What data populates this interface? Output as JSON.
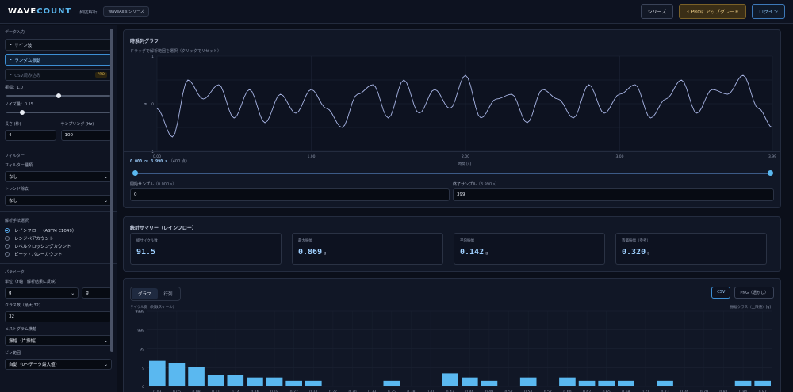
{
  "header": {
    "logo_main": "WAVE",
    "logo_accent": "COUNT",
    "subtitle": "頻度解析",
    "series_pill": "WaveAxis シリーズ",
    "series_button": "シリーズ",
    "pro_button": "PROにアップグレード",
    "login_button": "ログイン"
  },
  "sidebar": {
    "data_input": {
      "heading": "データ入力",
      "options": [
        {
          "label": "サイン波",
          "active": false
        },
        {
          "label": "ランダム振動",
          "active": true
        },
        {
          "label": "CSV読み込み",
          "tag": "PRO",
          "active": false
        }
      ],
      "amplitude_label": "振幅：1.0",
      "amplitude_level": 0.5,
      "noise_label": "ノイズ量：0.15",
      "noise_level": 0.15,
      "length_label": "長さ (秒)",
      "length_value": "4",
      "sampling_label": "サンプリング (Hz)",
      "sampling_value": "100"
    },
    "filter": {
      "heading": "フィルター",
      "type_label": "フィルター種類",
      "type_value": "なし",
      "trend_label": "トレンド除去",
      "trend_value": "なし"
    },
    "method": {
      "heading": "解析手法選択",
      "options": [
        {
          "label": "レインフロー（ASTM E1049）",
          "checked": true
        },
        {
          "label": "レンジペアカウント",
          "checked": false
        },
        {
          "label": "レベルクロッシングカウント",
          "checked": false
        },
        {
          "label": "ピーク・バレーカウント",
          "checked": false
        }
      ]
    },
    "params": {
      "heading": "パラメータ",
      "unit_label": "単位（Y軸・解析結果に反映）",
      "unit_value": "g",
      "unit_custom": "g",
      "class_label": "クラス数（最大 32）",
      "class_value": "32",
      "hist_label": "ヒストグラム横軸",
      "hist_value": "振幅（片振幅）",
      "bin_label": "ビン範囲",
      "bin_value": "自動（0〜データ最大値）"
    },
    "chevron": "˄"
  },
  "timeseries": {
    "title": "時系列グラフ",
    "hint": "ドラッグで解析範囲を選択（クリックでリセット）",
    "xlabel": "時間 [s]",
    "ylabel": "g",
    "range_text": "0.000 ～ 3.990 s",
    "range_count": "（400 点）",
    "start_label": "開始サンプル",
    "start_sub": "（0.000 s）",
    "start_value": "0",
    "end_label": "終了サンプル",
    "end_sub": "（3.990 s）",
    "end_value": "399"
  },
  "summary": {
    "title": "統計サマリー（レインフロー）",
    "cards": [
      {
        "label": "総サイクル数",
        "value": "91.5",
        "unit": ""
      },
      {
        "label": "最大振幅",
        "value": "0.869",
        "unit": "g"
      },
      {
        "label": "平均振幅",
        "value": "0.142",
        "unit": "g"
      },
      {
        "label": "等価振幅（参考）",
        "value": "0.320",
        "unit": "g"
      }
    ]
  },
  "histogram": {
    "tab_graph": "グラフ",
    "tab_matrix": "行列",
    "csv_button": "CSV",
    "png_button": "PNG（透かし）",
    "ylabel": "サイクル数（対数スケール）",
    "xlabel": "振幅クラス（上限値）[g]"
  },
  "chart_data": [
    {
      "type": "line",
      "title": "時系列グラフ",
      "xlabel": "時間 [s]",
      "ylabel": "g",
      "xlim": [
        0,
        3.99
      ],
      "ylim": [
        -1,
        1
      ],
      "xticks": [
        "0.00",
        "1.00",
        "2.00",
        "3.00",
        "3.99"
      ],
      "yticks": [
        "1",
        "0",
        "-1"
      ],
      "x": [
        0,
        0.1,
        0.2,
        0.3,
        0.4,
        0.5,
        0.6,
        0.7,
        0.8,
        0.9,
        1.0,
        1.1,
        1.2,
        1.3,
        1.4,
        1.5,
        1.6,
        1.7,
        1.8,
        1.9,
        2.0,
        2.1,
        2.2,
        2.3,
        2.4,
        2.5,
        2.6,
        2.7,
        2.8,
        2.9,
        3.0,
        3.1,
        3.2,
        3.3,
        3.4,
        3.5,
        3.6,
        3.7,
        3.8,
        3.9,
        3.99
      ],
      "y": [
        -0.1,
        -0.7,
        0.5,
        0.1,
        0.4,
        -0.3,
        0.3,
        -0.4,
        0.2,
        -0.2,
        0.3,
        -0.1,
        -0.5,
        0.2,
        0.4,
        -0.3,
        0.5,
        -0.2,
        0.3,
        -0.1,
        0.6,
        -0.3,
        0.1,
        0.2,
        -0.4,
        0.3,
        0.1,
        -0.3,
        0.4,
        -0.2,
        0.2,
        0.4,
        -0.3,
        0.1,
        0.5,
        -0.2,
        0.3,
        0.2,
        0.6,
        -0.1,
        -0.5
      ]
    },
    {
      "type": "bar",
      "ylabel": "サイクル数（対数スケール）",
      "xlabel": "振幅クラス（上限値）[g]",
      "yscale": "log",
      "ylim": [
        0,
        9999
      ],
      "yticks": [
        "9999",
        "999",
        "99",
        "9",
        "0"
      ],
      "categories": [
        "0.03",
        "0.05",
        "0.08",
        "0.11",
        "0.14",
        "0.16",
        "0.19",
        "0.22",
        "0.24",
        "0.27",
        "0.30",
        "0.33",
        "0.35",
        "0.38",
        "0.41",
        "0.43",
        "0.46",
        "0.49",
        "0.52",
        "0.54",
        "0.57",
        "0.60",
        "0.62",
        "0.65",
        "0.68",
        "0.71",
        "0.73",
        "0.76",
        "0.79",
        "0.82",
        "0.84",
        "0.87"
      ],
      "values": [
        22,
        17,
        10,
        3,
        3,
        2,
        2,
        1,
        1,
        0,
        0,
        0,
        1,
        0,
        0,
        4,
        2,
        1,
        0,
        2,
        0,
        2,
        1,
        1,
        1,
        0,
        1,
        0,
        0,
        0,
        1,
        1
      ]
    }
  ]
}
